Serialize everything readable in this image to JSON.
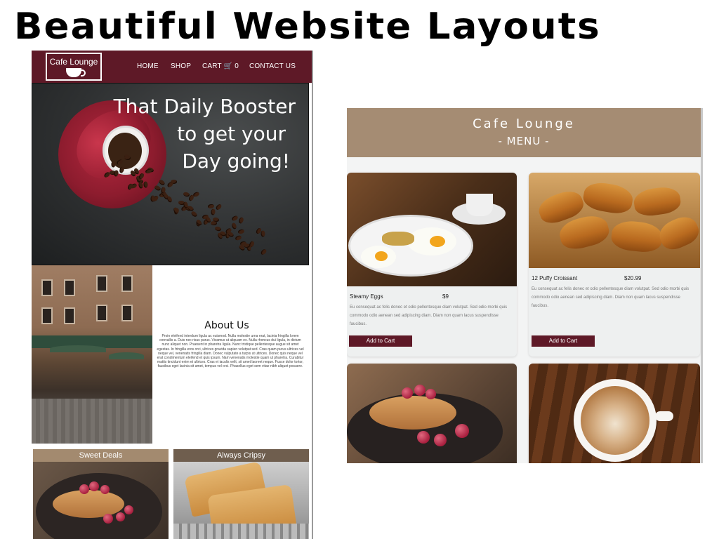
{
  "page_heading": "Beautiful Website Layouts",
  "left_site": {
    "logo_text": "Cafe Lounge",
    "nav": {
      "home": "HOME",
      "shop": "SHOP",
      "cart": "CART",
      "cart_icon": "shopping-cart-icon",
      "cart_count": "0",
      "contact": "CONTACT US"
    },
    "hero": {
      "line1": "That Daily Booster",
      "line2": "to get your",
      "line3": "Day going!"
    },
    "about": {
      "title": "About Us",
      "body": "Proin eleifend interdum ligula ac euismod. Nulla molestie urna erat, lacinia fringilla lorem convallis a. Duis nec risus purus. Vivamus ut aliquam ex. Nulla rhoncus dui ligula, in dictum nunc aliquet non. Praesent in pharetra ligula. Nunc tristique pellentesque augue sit amet egestas. In fringilla eros orci, ultrices gravida sapien volutpat sed. Cras quam purus ultrices vel neque vel, venenatis fringilla diam. Donec vulputate a turpis ut ultrices. Donec quis neque vel erat condimentum eleifend et quis ipsum. Nam venenatis molestie quam ut pharetra. Curabitur mattis tincidunt enim et ultrices. Cras et iaculis velit, sit amet laoreet neque. Fusce dolor tortor, faucibus eget lacinia sit amet, tempus vel orci. Phasellus eget sem vitae nibh aliquet posuere."
    },
    "deals": [
      {
        "label": "Sweet Deals"
      },
      {
        "label": "Always Cripsy"
      }
    ]
  },
  "right_site": {
    "title": "Cafe Lounge",
    "subtitle": "- MENU -",
    "items": [
      {
        "name": "Steamy Eggs",
        "price": "$9",
        "description": "Eu consequat ac felis donec et odio pellentesque diam volutpat. Sed odio morbi quis commodo odio aenean sed adipiscing diam. Diam non quam lacus suspendisse faucibus.",
        "button": "Add to Cart"
      },
      {
        "name": "12 Puffy Croissant",
        "price": "$20.99",
        "description": "Eu consequat ac felis donec et odio pellentesque diam volutpat. Sed odio morbi quis commodo odio aenean sed adipiscing diam. Diam non quam lacus suspendisse faucibus.",
        "button": "Add to Cart"
      }
    ]
  },
  "colors": {
    "nav_maroon": "#5e1927",
    "menu_tan": "#a58c73",
    "deal_bar": "#a38a6f"
  }
}
